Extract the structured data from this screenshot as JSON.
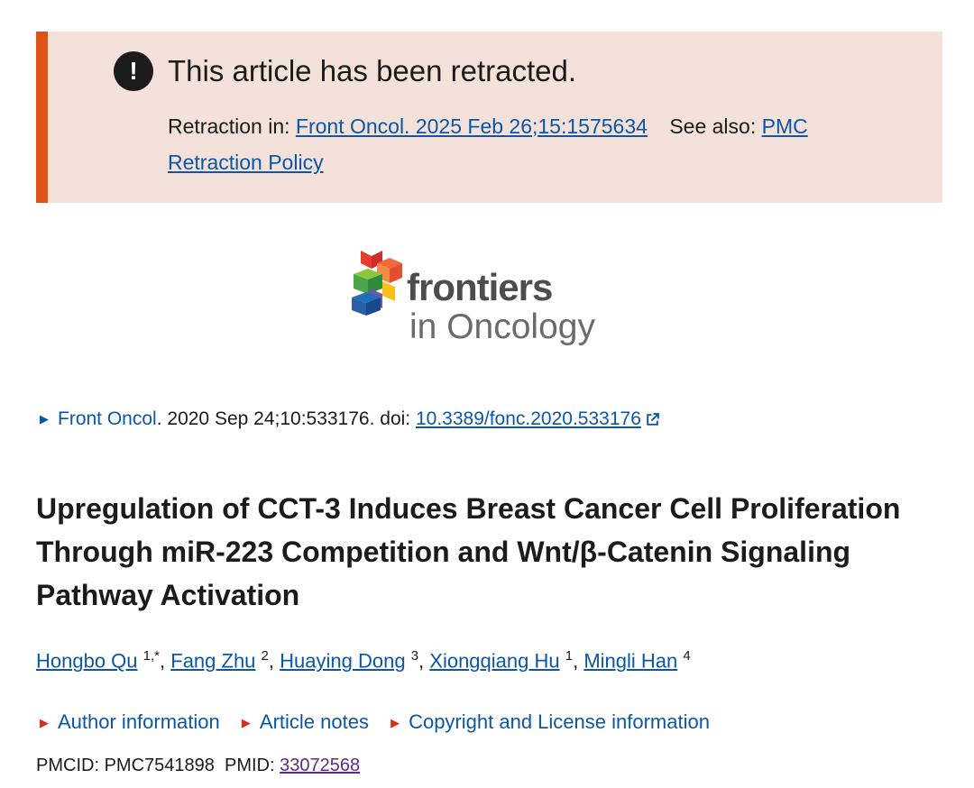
{
  "banner": {
    "title": "This article has been retracted.",
    "retraction_label": "Retraction in:",
    "retraction_link": "Front Oncol. 2025 Feb 26;15:1575634",
    "see_also_label": "See also:",
    "see_also_link_part1": "PMC",
    "see_also_link_part2": "Retraction Policy",
    "accent_color": "#e05215",
    "background_color": "#f4e2da"
  },
  "logo": {
    "line1": "frontiers",
    "line2": "in Oncology"
  },
  "citation": {
    "journal": "Front Oncol",
    "details": ". 2020 Sep 24;10:533176. doi: ",
    "doi": "10.3389/fonc.2020.533176"
  },
  "article": {
    "title": "Upregulation of CCT-3 Induces Breast Cancer Cell Proliferation Through miR-223 Competition and Wnt/β-Catenin Signaling Pathway Activation"
  },
  "authors": [
    {
      "name": "Hongbo Qu",
      "aff": "1,*"
    },
    {
      "name": "Fang Zhu",
      "aff": "2"
    },
    {
      "name": "Huaying Dong",
      "aff": "3"
    },
    {
      "name": "Xiongqiang Hu",
      "aff": "1"
    },
    {
      "name": "Mingli Han",
      "aff": "4"
    }
  ],
  "toggles": [
    "Author information",
    "Article notes",
    "Copyright and License information"
  ],
  "ids": {
    "pmcid_label": "PMCID:",
    "pmcid": "PMC7541898",
    "pmid_label": "PMID:",
    "pmid": "33072568"
  }
}
